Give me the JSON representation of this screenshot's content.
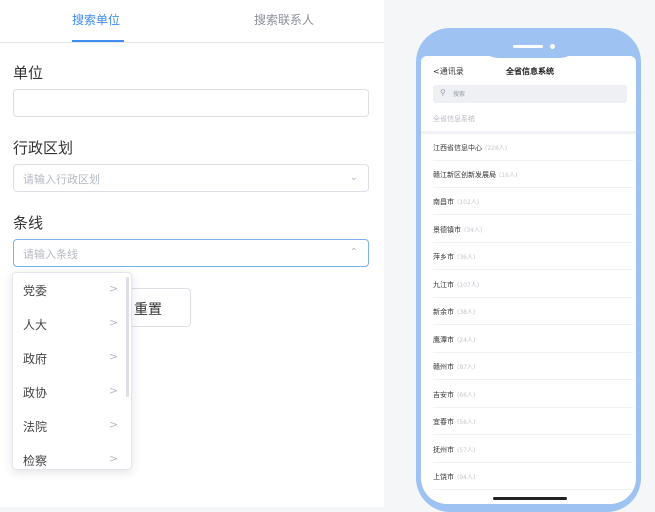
{
  "tabs": [
    {
      "label": "搜索单位",
      "active": true
    },
    {
      "label": "搜索联系人",
      "active": false
    }
  ],
  "form": {
    "unit_label": "单位",
    "unit_value": "",
    "region_label": "行政区划",
    "region_placeholder": "请输入行政区划",
    "line_label": "条线",
    "line_placeholder": "请输入条线",
    "reset_label": "重置"
  },
  "dropdown": {
    "items": [
      "党委",
      "人大",
      "政府",
      "政协",
      "法院",
      "检察"
    ]
  },
  "phone": {
    "back_label": "通讯录",
    "title": "全省信息系统",
    "search_placeholder": "搜索",
    "breadcrumb": "全省信息系统",
    "rows": [
      {
        "name": "江西省信息中心",
        "count": "(228人)"
      },
      {
        "name": "赣江新区创新发展局",
        "count": "(16人)"
      },
      {
        "name": "南昌市",
        "count": "(102人)"
      },
      {
        "name": "景德镇市",
        "count": "(34人)"
      },
      {
        "name": "萍乡市",
        "count": "(36人)"
      },
      {
        "name": "九江市",
        "count": "(107人)"
      },
      {
        "name": "新余市",
        "count": "(38人)"
      },
      {
        "name": "鹰潭市",
        "count": "(24人)"
      },
      {
        "name": "赣州市",
        "count": "(87人)"
      },
      {
        "name": "吉安市",
        "count": "(66人)"
      },
      {
        "name": "宜春市",
        "count": "(56人)"
      },
      {
        "name": "抚州市",
        "count": "(57人)"
      },
      {
        "name": "上饶市",
        "count": "(94人)"
      }
    ]
  },
  "colors": {
    "accent": "#3f8cf2",
    "phone_frame": "#9ec2f2"
  },
  "icons": {
    "back": "chevron-left-icon",
    "search": "search-icon",
    "arrow": "chevron-right-icon"
  }
}
